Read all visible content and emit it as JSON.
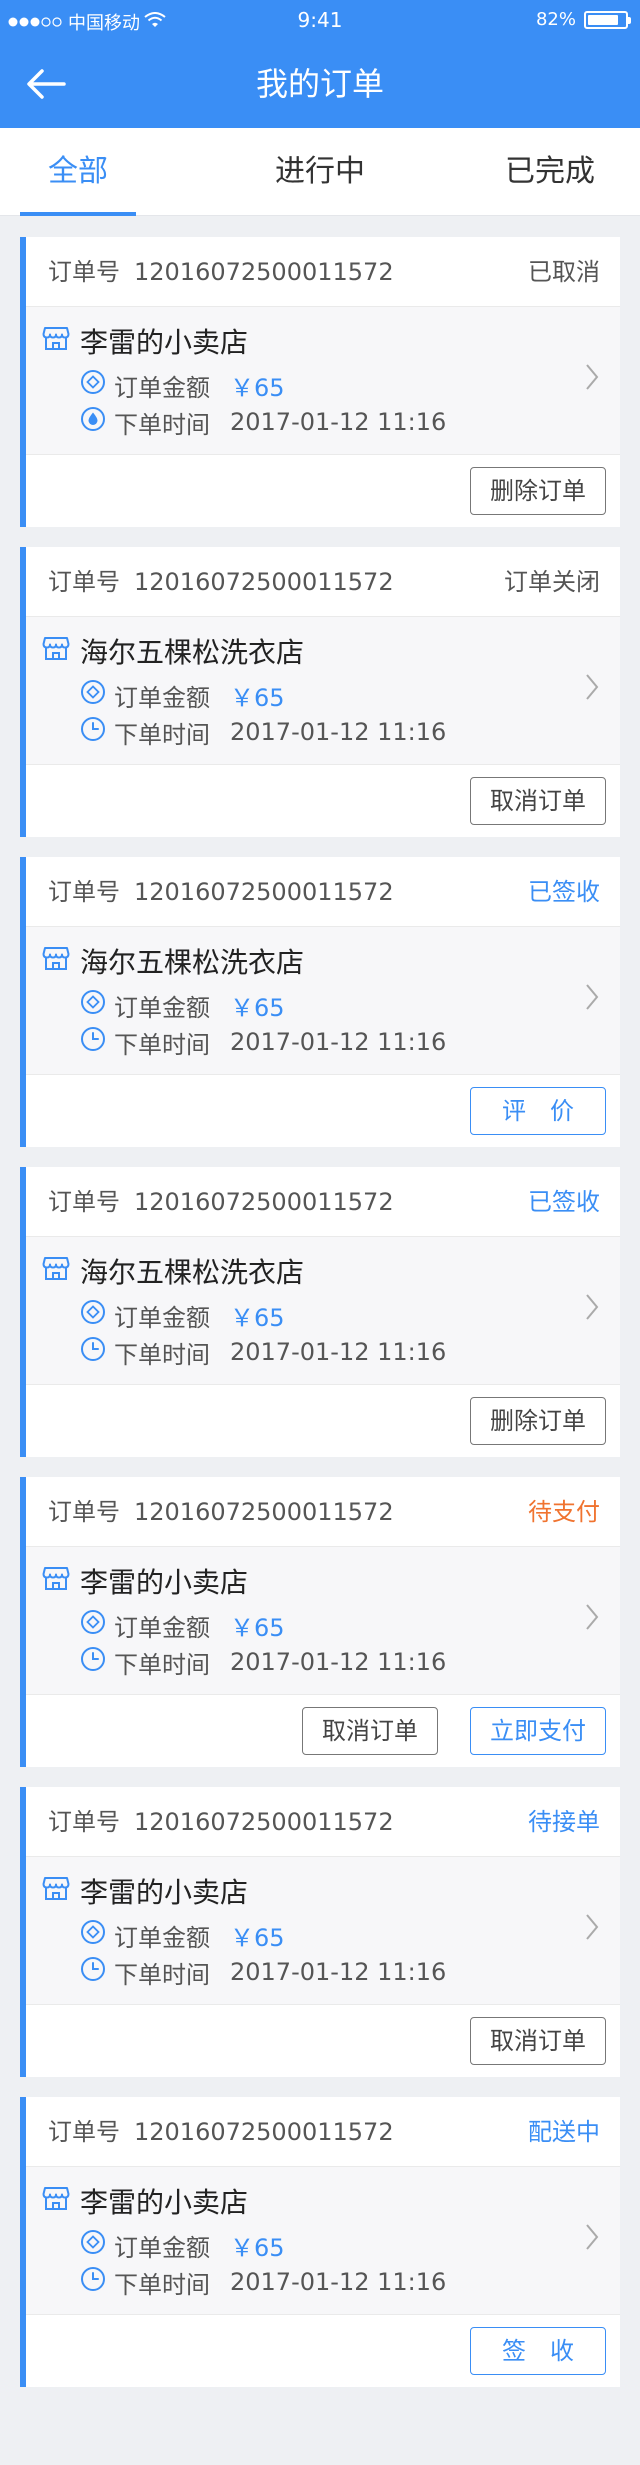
{
  "status_bar": {
    "carrier": "中国移动",
    "time": "9:41",
    "battery": "82%",
    "battery_level": 0.82
  },
  "nav": {
    "title": "我的订单"
  },
  "tabs": [
    {
      "label": "全部",
      "active": true
    },
    {
      "label": "进行中",
      "active": false
    },
    {
      "label": "已完成",
      "active": false
    }
  ],
  "labels": {
    "order_no": "订单号",
    "amount": "订单金额",
    "time": "下单时间"
  },
  "colors": {
    "primary": "#3a8ef5",
    "pending_pay": "#f0732f",
    "muted": "#555555"
  },
  "orders": [
    {
      "order_no": "12016072500011572",
      "status": "已取消",
      "status_color": "#555555",
      "shop": "李雷的小卖店",
      "amount": "￥65",
      "time": "2017-01-12 11:16",
      "buttons": [
        {
          "label": "删除订单",
          "style": "gray"
        }
      ]
    },
    {
      "order_no": "12016072500011572",
      "status": "订单关闭",
      "status_color": "#555555",
      "shop": "海尔五棵松洗衣店",
      "amount": "￥65",
      "time": "2017-01-12 11:16",
      "buttons": [
        {
          "label": "取消订单",
          "style": "gray"
        }
      ]
    },
    {
      "order_no": "12016072500011572",
      "status": "已签收",
      "status_color": "#3a8ef5",
      "shop": "海尔五棵松洗衣店",
      "amount": "￥65",
      "time": "2017-01-12 11:16",
      "buttons": [
        {
          "label": "评　价",
          "style": "blue"
        }
      ]
    },
    {
      "order_no": "12016072500011572",
      "status": "已签收",
      "status_color": "#3a8ef5",
      "shop": "海尔五棵松洗衣店",
      "amount": "￥65",
      "time": "2017-01-12 11:16",
      "buttons": [
        {
          "label": "删除订单",
          "style": "gray"
        }
      ]
    },
    {
      "order_no": "12016072500011572",
      "status": "待支付",
      "status_color": "#f0732f",
      "shop": "李雷的小卖店",
      "amount": "￥65",
      "time": "2017-01-12 11:16",
      "buttons": [
        {
          "label": "取消订单",
          "style": "gray"
        },
        {
          "label": "立即支付",
          "style": "blue"
        }
      ]
    },
    {
      "order_no": "12016072500011572",
      "status": "待接单",
      "status_color": "#3a8ef5",
      "shop": "李雷的小卖店",
      "amount": "￥65",
      "time": "2017-01-12 11:16",
      "buttons": [
        {
          "label": "取消订单",
          "style": "gray"
        }
      ]
    },
    {
      "order_no": "12016072500011572",
      "status": "配送中",
      "status_color": "#3a8ef5",
      "shop": "李雷的小卖店",
      "amount": "￥65",
      "time": "2017-01-12 11:16",
      "buttons": [
        {
          "label": "签　收",
          "style": "blue"
        }
      ]
    }
  ]
}
